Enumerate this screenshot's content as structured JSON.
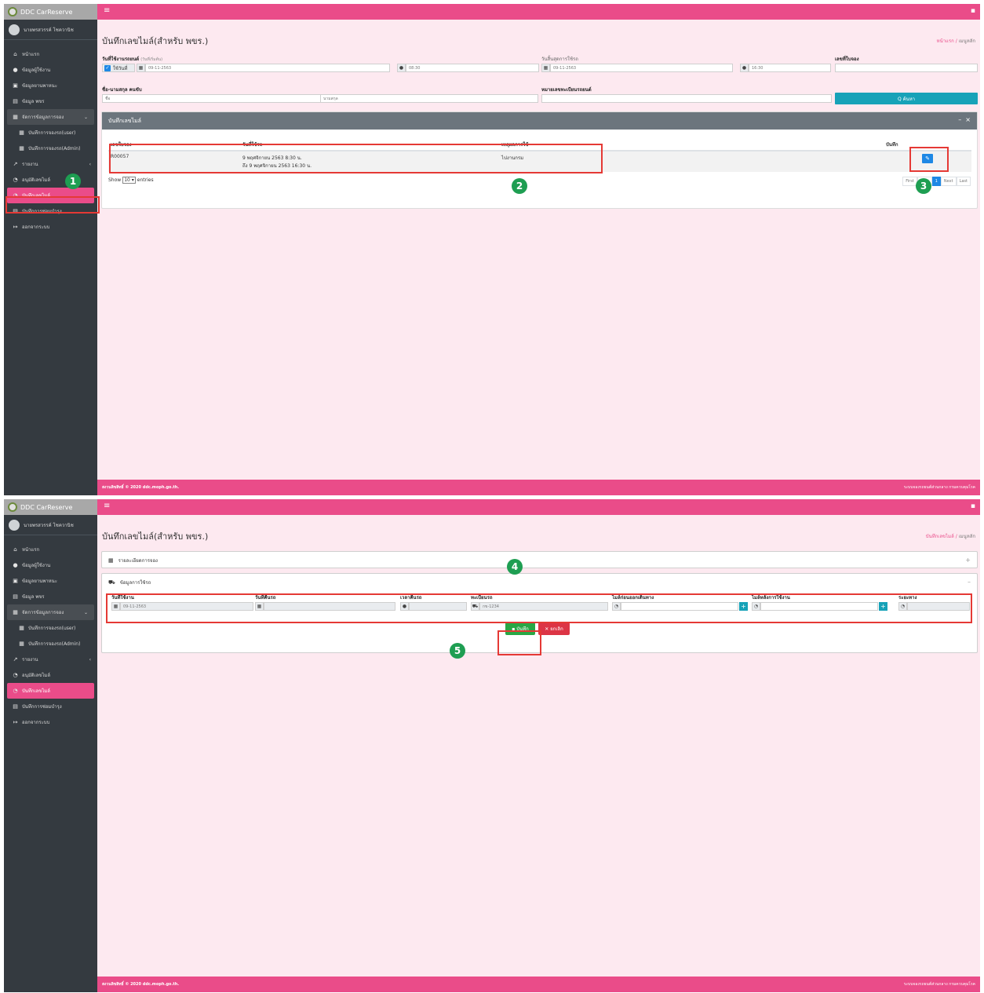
{
  "app": {
    "brand": "DDC CarReserve",
    "user_name": "นายพรสวรรค์ โชควานิช",
    "menu": {
      "home": "หน้าแรก",
      "user_info": "ข้อมูลผู้ใช้งาน",
      "vehicle_info": "ข้อมูลยานพาหนะ",
      "driver_info": "ข้อมูล พขร",
      "manage_booking": "จัดการข้อมูลการจอง",
      "booking_user": "บันทึกการจองรถ(user)",
      "booking_admin": "บันทึกการจองรถ(Admin)",
      "report": "รายงาน",
      "approve_mileage": "อนุมัติเลขไมล์",
      "record_mileage": "บันทึกเลขไมล์",
      "maintenance": "บันทึกการซ่อมบำรุง",
      "logout": "ออกจากระบบ"
    },
    "footer_left": "สงวนลิขสิทธิ์ © 2020 ddc.moph.go.th.",
    "footer_right": "ระบบจองรถยนต์ส่วนกลาง กรมควบคุมโรค"
  },
  "screen1": {
    "title": "บันทึกเลขไมล์(สำหรับ พขร.)",
    "crumb_home": "หน้าแรก",
    "crumb_current": "เมนูหลัก",
    "filters": {
      "use_date_label": "วันที่ใช้งานรถยนต์",
      "use_date_hint": "(วันที่เริ่มต้น)",
      "use_date_check": "ใช้วันที่",
      "start_date": "09-11-2563",
      "start_time": "08:30",
      "end_date_label": "วันสิ้นสุดการใช้รถ",
      "end_date": "09-11-2563",
      "end_time": "16:30",
      "booking_no_label": "เลขที่ใบจอง",
      "booking_no": "",
      "driver_label": "ชื่อ-นามสกุล คนขับ",
      "first_name_ph": "ชื่อ",
      "last_name_ph": "นามสกุล",
      "plate_label": "หมายเลขทะเบียนรถยนต์",
      "plate": "",
      "search_button": "Q ค้นหา"
    },
    "card_title": "บันทึกเลขไมล์",
    "table": {
      "headers": [
        "เลขใบจอง",
        "วันที่ใช้รถ",
        "เหตุผลการใช้",
        "บันทึก"
      ],
      "rows": [
        {
          "booking_no": "R00057",
          "date_line1": "9 พฤศจิกายน 2563 8:30 น.",
          "date_line2": "ถึง 9 พฤศจิกายน 2563 16:30 น.",
          "reason": "ไปงานกรม",
          "edit_icon": "pencil-icon"
        }
      ]
    },
    "show_prefix": "Show",
    "show_value": "10 ▾",
    "show_suffix": "entries",
    "pager": [
      "First",
      "Prev",
      "1",
      "Next",
      "Last"
    ]
  },
  "screen2": {
    "title": "บันทึกเลขไมล์(สำหรับ พขร.)",
    "crumb_home": "บันทึกเลขไมล์",
    "crumb_current": "เมนูหลัก",
    "booking_details_title": "รายละเอียดการจอง",
    "usage_title": "ข้อมูลการใช้รถ",
    "fields": {
      "use_date_label": "วันที่ใช้งาน",
      "use_date": "09-11-2563",
      "return_date_label": "วันที่คืนรถ",
      "return_date": "",
      "return_time_label": "เวลาคืนรถ",
      "return_time": "",
      "plate_label": "ทะเบียนรถ",
      "plate": "กข-1234",
      "mile_before_label": "ไมล์ก่อนออกเดินทาง",
      "mile_before": "",
      "mile_after_label": "ไมล์หลังการใช้งาน",
      "mile_after": "",
      "distance_label": "ระยะทาง",
      "distance": ""
    },
    "save_button": "บันทึก",
    "cancel_button": "ยกเลิก"
  },
  "annotations": [
    "1",
    "2",
    "3",
    "4",
    "5"
  ],
  "colors": {
    "brand_pink": "#ea4c89",
    "sidebar": "#343a40",
    "highlight": "#e53935",
    "badge": "#1e9e52"
  }
}
